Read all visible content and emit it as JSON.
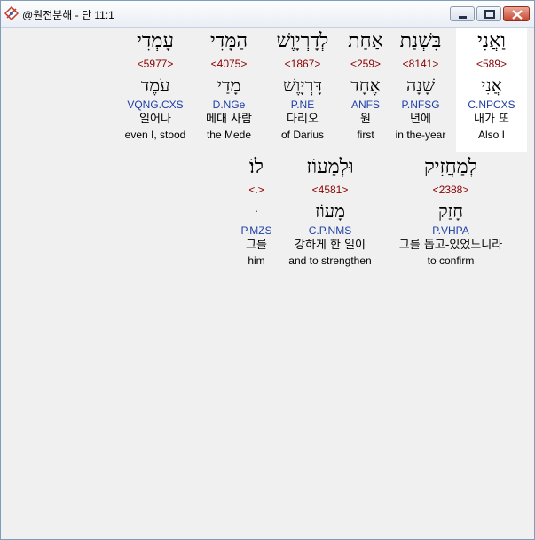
{
  "window": {
    "title": "@원전분해 - 단 11:1",
    "minimize_label": "minimize",
    "maximize_label": "maximize",
    "close_label": "close"
  },
  "rows": [
    {
      "words": [
        {
          "hebrew": "וַאֲנִי",
          "strong": "<589>",
          "lemma": "אֲנִי",
          "morph": "C.NPCXS",
          "korean": "내가 또",
          "english": "Also I",
          "highlight": true
        },
        {
          "hebrew": "בִּשְׁנַת",
          "strong": "<8141>",
          "lemma": "שָׁנָה",
          "morph": "P.NFSG",
          "korean": "년에",
          "english": "in the-year",
          "highlight": false
        },
        {
          "hebrew": "אַחַת",
          "strong": "<259>",
          "lemma": "אֶחָד",
          "morph": "ANFS",
          "korean": "원",
          "english": "first",
          "highlight": false
        },
        {
          "hebrew": "לְדָרְיָוֶשׁ",
          "strong": "<1867>",
          "lemma": "דָּרְיָוֶשׁ",
          "morph": "P.NE",
          "korean": "다리오",
          "english": "of Darius",
          "highlight": false
        },
        {
          "hebrew": "הַמָּדִי",
          "strong": "<4075>",
          "lemma": "מָדַי",
          "morph": "D.NGe",
          "korean": "메대 사람",
          "english": "the Mede",
          "highlight": false
        },
        {
          "hebrew": "עָמְדִי",
          "strong": "<5977>",
          "lemma": "עֹמֶד",
          "morph": "VQNG.CXS",
          "korean": "일어나",
          "english": "even I, stood",
          "highlight": false
        }
      ]
    },
    {
      "words": [
        {
          "hebrew": "לְמַחֲזִיק",
          "strong": "<2388>",
          "lemma": "חָזַק",
          "morph": "P.VHPA",
          "korean": "그를 돕고-있었느니라",
          "english": "to confirm",
          "highlight": false
        },
        {
          "hebrew": "וּלְמָעוֹז",
          "strong": "<4581>",
          "lemma": "מָעוֹז",
          "morph": "C.P.NMS",
          "korean": "강하게 한 일이",
          "english": "and to strengthen",
          "highlight": false
        },
        {
          "hebrew": "לוֹ׃",
          "strong": "<.>",
          "lemma": "ּ",
          "morph": "P.MZS",
          "korean": "그를",
          "english": "him",
          "highlight": false
        }
      ]
    }
  ]
}
